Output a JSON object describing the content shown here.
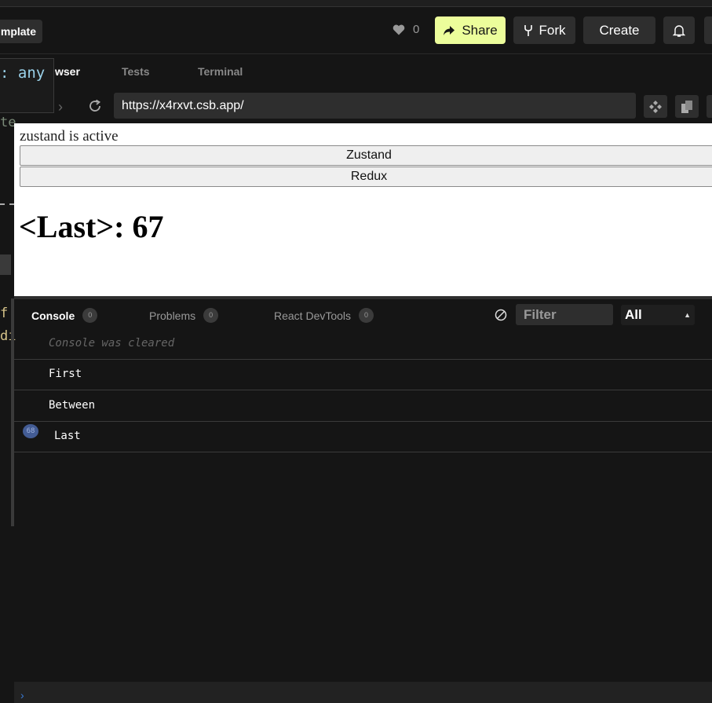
{
  "header": {
    "template_label": "mplate",
    "likes_count": "0",
    "share_label": "Share",
    "fork_label": "Fork",
    "create_label": "Create"
  },
  "editor": {
    "tooltip_text": ": any",
    "fragments": [
      "te",
      "f",
      "di"
    ]
  },
  "preview_tabs": [
    {
      "label": "wser"
    },
    {
      "label": "Tests"
    },
    {
      "label": "Terminal"
    }
  ],
  "url": "https://x4rxvt.csb.app/",
  "preview": {
    "status_text": "zustand is active",
    "button_zustand": "Zustand",
    "button_redux": "Redux",
    "heading": "<Last>: 67"
  },
  "console": {
    "tabs": [
      {
        "label": "Console",
        "count": "0"
      },
      {
        "label": "Problems",
        "count": "0"
      },
      {
        "label": "React DevTools",
        "count": "0"
      }
    ],
    "filter_placeholder": "Filter",
    "level": "All",
    "logs": [
      {
        "text": "Console was cleared"
      },
      {
        "text": "First"
      },
      {
        "text": "Between"
      },
      {
        "text": "Last",
        "count": "68"
      }
    ]
  },
  "colors": {
    "accent": "#ecfd9b",
    "background": "#151515",
    "panel": "#2e2e2e"
  }
}
